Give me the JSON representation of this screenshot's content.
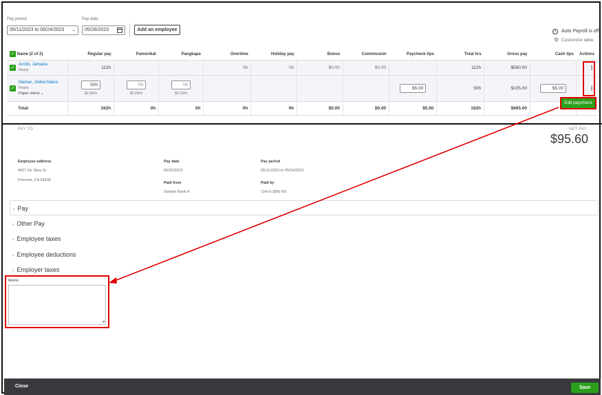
{
  "filters": {
    "pay_period_label": "Pay period",
    "pay_period_value": "05/11/2023 to 05/24/2023",
    "pay_date_label": "Pay date",
    "pay_date_value": "05/26/2023",
    "add_employee_label": "Add an employee"
  },
  "top_right": {
    "auto_payroll": "Auto Payroll is off",
    "customize": "Customize table"
  },
  "table": {
    "headers": {
      "name": "Name (2 of 2)",
      "regular_pay": "Regular pay",
      "pamorikat": "Pamorikat",
      "pangkape": "Pangkape",
      "overtime": "Overtime",
      "holiday": "Holiday pay",
      "bonus": "Bonus",
      "commission": "Commission",
      "paycheck_tips": "Paycheck tips",
      "total_hrs": "Total hrs",
      "gross_pay": "Gross pay",
      "cash_tips": "Cash tips",
      "actions": "Actions"
    },
    "rows": [
      {
        "name": "Arcillo, Jamaica",
        "type": "Hourly",
        "regular_pay": "112h",
        "overtime": "0h",
        "holiday": "0h",
        "bonus": "$0.00",
        "commission": "$0.00",
        "total_hrs": "112h",
        "gross_pay": "$560.00",
        "actions": "⋮"
      },
      {
        "name": "Mamac, Gebel Alaina",
        "type": "Hourly",
        "method": "Paper check",
        "regular_pay": "50h",
        "regular_rate": "$2.00/hr",
        "pamorikat": "0h",
        "pamorikat_rate": "$0.25/hr",
        "pangkape": "0h",
        "pangkape_rate": "$0.10/hr",
        "paycheck_tips": "$5.00",
        "total_hrs": "50h",
        "gross_pay": "$105.00",
        "cash_tips": "$5.00",
        "actions": "⋮"
      }
    ],
    "total": {
      "label": "Total",
      "regular_pay": "162h",
      "pamorikat": "0h",
      "pangkape": "0h",
      "overtime": "0h",
      "holiday": "0h",
      "bonus": "$0.00",
      "commission": "$0.00",
      "paycheck_tips": "$5.00",
      "total_hrs": "162h",
      "gross_pay": "$665.00",
      "cash_tips": "$5.00"
    }
  },
  "edit_paycheck_label": "Edit paycheck",
  "paycheck": {
    "pay_to_label": "PAY TO",
    "net_pay_label": "NET PAY",
    "net_pay_value": "$95.60",
    "employee_address_label": "Employee address",
    "address_line1": "4557 De Silva St",
    "address_line2": "Fremont, CA 94538",
    "pay_date_label": "Pay date",
    "pay_date_value": "05/26/2023",
    "paid_from_label": "Paid from",
    "paid_from_value": "Sample Bank A",
    "pay_period_label": "Pay period",
    "pay_period_value": "05/11/2023 to 05/24/2023",
    "paid_by_label": "Paid by",
    "paid_by_value": "Check ($95.60)",
    "sections": [
      "Pay",
      "Other Pay",
      "Employee taxes",
      "Employee deductions",
      "Employer taxes"
    ],
    "memo_label": "Memo"
  },
  "footer": {
    "close_label": "Close",
    "save_label": "Save"
  },
  "colors": {
    "accent_green": "#2ca01c",
    "annotation_red": "#e00000",
    "link_blue": "#0077c5",
    "footer_dark": "#393a3d"
  }
}
